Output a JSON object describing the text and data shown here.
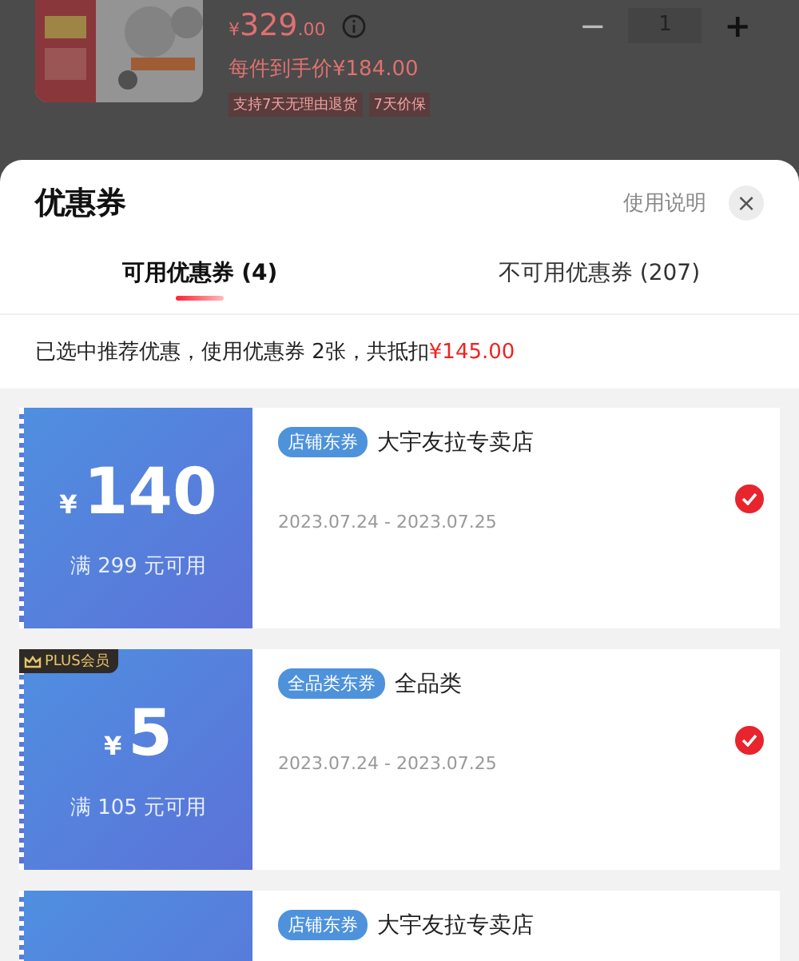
{
  "product": {
    "kind": "picture",
    "price_symbol": "¥",
    "price_int": "329",
    "price_dec": ".00",
    "quantity": "1",
    "minus": "−",
    "plus": "+",
    "final_price": "每件到手价¥184.00",
    "tags": [
      "支持7天无理由退货",
      "7天价保"
    ]
  },
  "sheet": {
    "title": "优惠券",
    "help": "使用说明",
    "close": "×"
  },
  "tabs": [
    {
      "label": "可用优惠券 (4)",
      "selected": true
    },
    {
      "label": "不可用优惠券 (207)",
      "selected": false
    }
  ],
  "summary": "已选中推荐优惠，使用优惠券 2张，共抵扣**¥145.00**",
  "coupons": [
    {
      "plus": false,
      "symbol": "¥",
      "amount": "140",
      "condition": "满 299 元可用",
      "tag": "店铺东券",
      "title": "大宇友拉专卖店",
      "dates": "2023.07.24 - 2023.07.25",
      "selected": true
    },
    {
      "plus": true,
      "plus_label": "PLUS会员",
      "symbol": "¥",
      "amount": "5",
      "condition": "满 105 元可用",
      "tag": "全品类东券",
      "title": "全品类",
      "dates": "2023.07.24 - 2023.07.25",
      "selected": true
    },
    {
      "plus": false,
      "tag": "店铺东券",
      "title": "大宇友拉专卖店"
    }
  ]
}
